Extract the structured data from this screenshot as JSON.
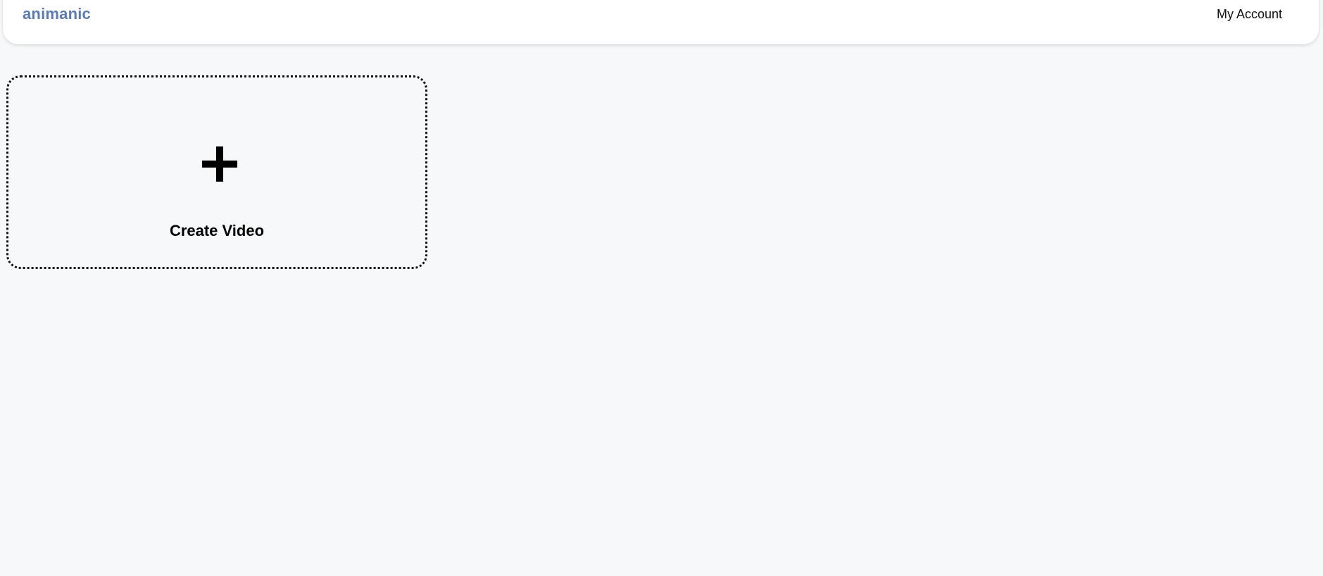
{
  "header": {
    "brand": "animanic",
    "account_label": "My Account"
  },
  "main": {
    "create_card": {
      "label": "Create Video",
      "icon": "plus-icon"
    }
  },
  "colors": {
    "brand": "#5a7ab4",
    "background": "#f7f8fa",
    "header_bg": "#ffffff",
    "text": "#111111"
  }
}
